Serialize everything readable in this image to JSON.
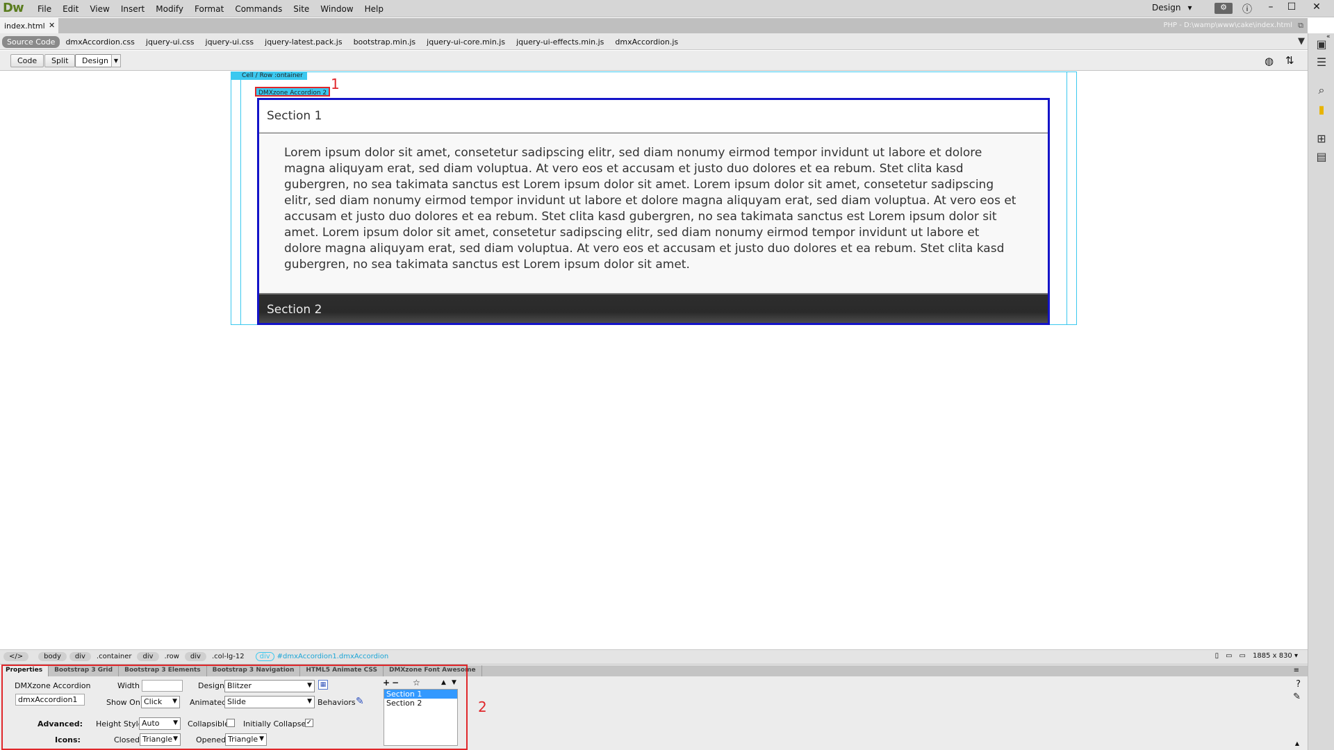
{
  "app": {
    "logo": "Dw",
    "menu": [
      "File",
      "Edit",
      "View",
      "Insert",
      "Modify",
      "Format",
      "Commands",
      "Site",
      "Window",
      "Help"
    ],
    "workspace": "Design",
    "workspace_caret": "▾",
    "window_buttons": [
      "–",
      "☐",
      "✕"
    ]
  },
  "document": {
    "tab_title": "index.html",
    "tab_close": "✕",
    "path": "PHP - D:\\wamp\\www\\cake\\index.html",
    "related_files": [
      "Source Code",
      "dmxAccordion.css",
      "jquery-ui.css",
      "jquery-ui.css",
      "jquery-latest.pack.js",
      "bootstrap.min.js",
      "jquery-ui-core.min.js",
      "jquery-ui-effects.min.js",
      "dmxAccordion.js"
    ],
    "views": {
      "code": "Code",
      "split": "Split",
      "design": "Design"
    }
  },
  "canvas": {
    "cell_label": "Cell / Row :ontainer",
    "accordion_tag": "DMXzone Accordion 2",
    "marker_1": "1",
    "section1_title": "Section 1",
    "section1_body": "Lorem ipsum dolor sit amet, consetetur sadipscing elitr, sed diam nonumy eirmod tempor invidunt ut labore et dolore magna aliquyam erat, sed diam voluptua. At vero eos et accusam et justo duo dolores et ea rebum. Stet clita kasd gubergren, no sea takimata sanctus est Lorem ipsum dolor sit amet. Lorem ipsum dolor sit amet, consetetur sadipscing elitr, sed diam nonumy eirmod tempor invidunt ut labore et dolore magna aliquyam erat, sed diam voluptua. At vero eos et accusam et justo duo dolores et ea rebum. Stet clita kasd gubergren, no sea takimata sanctus est Lorem ipsum dolor sit amet. Lorem ipsum dolor sit amet, consetetur sadipscing elitr, sed diam nonumy eirmod tempor invidunt ut labore et dolore magna aliquyam erat, sed diam voluptua. At vero eos et accusam et justo duo dolores et ea rebum. Stet clita kasd gubergren, no sea takimata sanctus est Lorem ipsum dolor sit amet.",
    "section2_title": "Section 2"
  },
  "tagbar": {
    "code_toggle": "</>",
    "body": "body",
    "div": "div",
    "container": ".container",
    "row": ".row",
    "col": ".col-lg-12",
    "active_path": "#dmxAccordion1.dmxAccordion",
    "size": "1885 x 830 ▾"
  },
  "inspector": {
    "tabs": [
      "Properties",
      "Bootstrap 3 Grid",
      "Bootstrap 3 Elements",
      "Bootstrap 3 Navigation",
      "HTML5 Animate CSS",
      "DMXzone Font Awesome"
    ],
    "component": "DMXzone Accordion",
    "id_value": "dmxAccordion1",
    "width_label": "Width",
    "width_value": "",
    "show_on_label": "Show On",
    "show_on_value": "Click",
    "design_label": "Design",
    "design_value": "Blitzer",
    "animated_label": "Animated",
    "animated_value": "Slide",
    "behaviors_label": "Behaviors",
    "advanced_label": "Advanced:",
    "height_style_label": "Height Style",
    "height_style_value": "Auto",
    "collapsible_label": "Collapsible",
    "collapsible_checked": "",
    "initially_collapsed_label": "Initially Collapsed",
    "initially_collapsed_checked": "✓",
    "icons_label": "Icons:",
    "closed_label": "Closed",
    "closed_value": "Triangle",
    "opened_label": "Opened",
    "opened_value": "Triangle",
    "sections": [
      "Section 1",
      "Section 2"
    ],
    "marker_2": "2"
  }
}
